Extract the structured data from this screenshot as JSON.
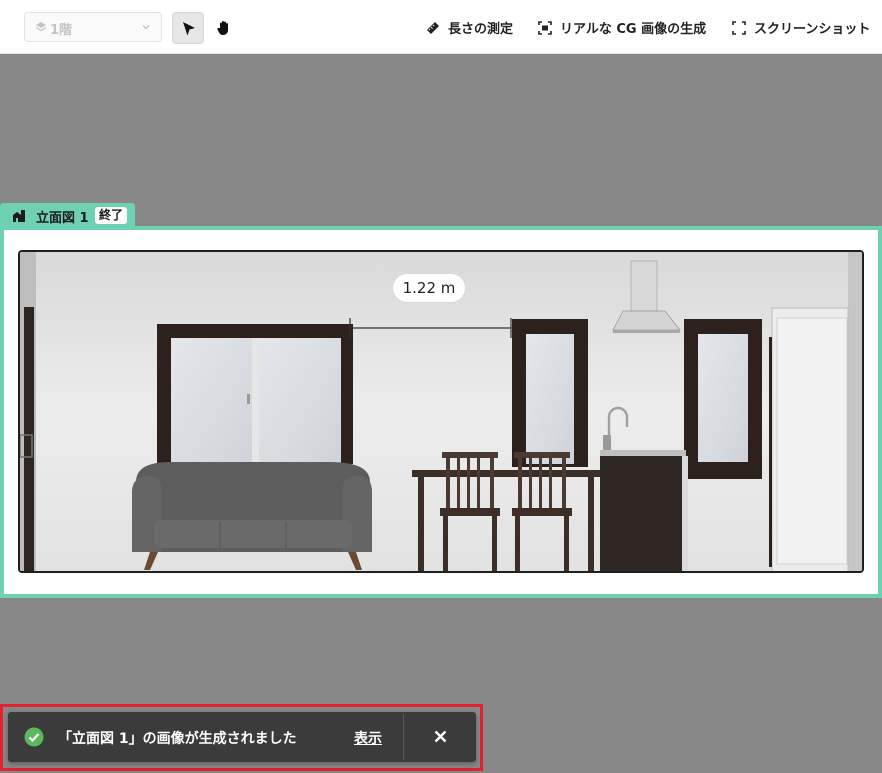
{
  "toolbar": {
    "floor_selector": {
      "value": "1階",
      "icon": "layers-icon"
    },
    "tools": [
      {
        "name": "select-tool",
        "icon": "cursor-arrow-icon",
        "active": true
      },
      {
        "name": "pan-tool",
        "icon": "hand-icon",
        "active": false
      }
    ],
    "actions": {
      "measure": {
        "label": "長さの測定",
        "icon": "ruler-icon"
      },
      "render_cg": {
        "label": "リアルな CG 画像の生成",
        "icon": "camera-frame-icon"
      },
      "screenshot": {
        "label": "スクリーンショット",
        "icon": "screenshot-frame-icon"
      }
    }
  },
  "elevation": {
    "tab_label": "立面図 1",
    "end_button": "終了",
    "accent_color": "#6fd1b4",
    "measurement": "1.22 m"
  },
  "toast": {
    "message": "「立面図 1」の画像が生成されました",
    "view_link": "表示",
    "close_icon": "close-x-icon",
    "status_icon": "check-circle-icon",
    "status_color": "#5cb85c",
    "highlight_color": "#e0232e"
  }
}
